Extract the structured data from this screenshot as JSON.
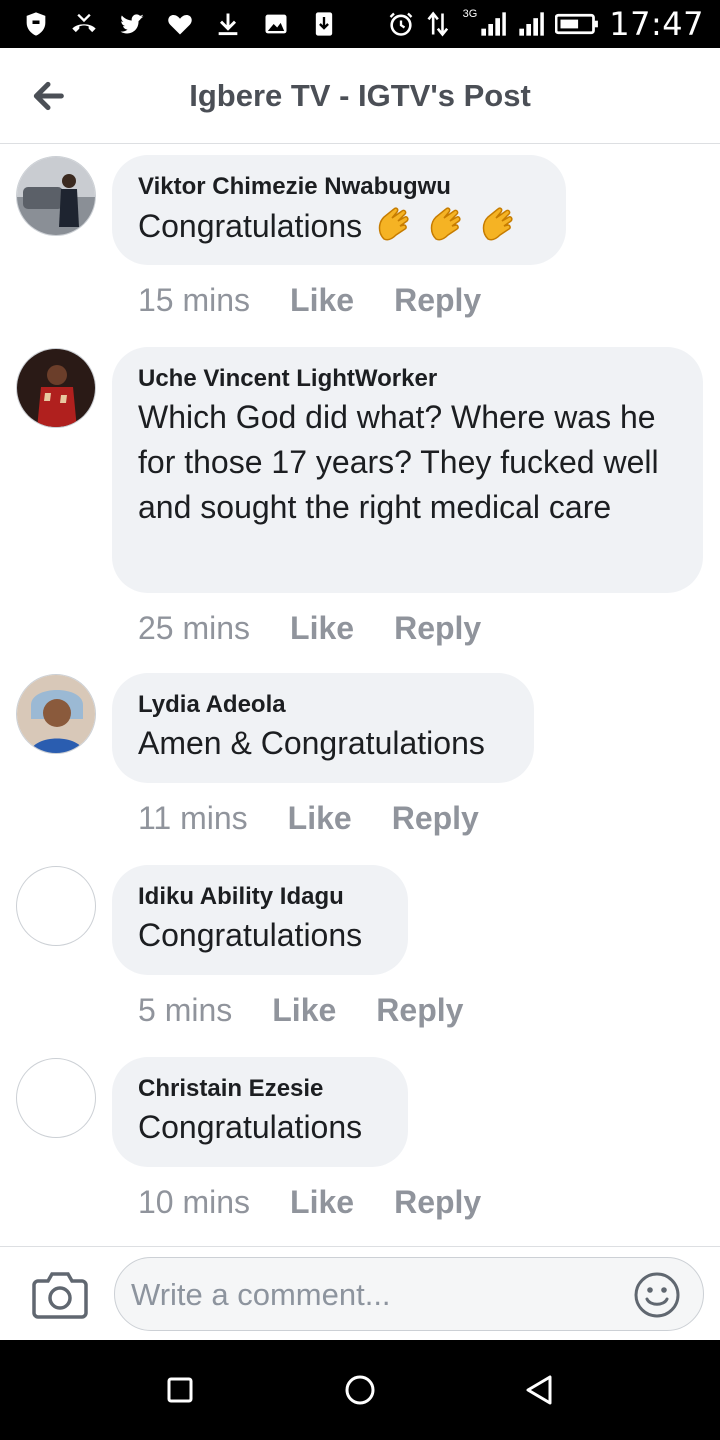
{
  "status_bar": {
    "time": "17:47",
    "network": "3G",
    "left_icons": [
      "shield-icon",
      "missed-call-icon",
      "twitter-icon",
      "heart-icon",
      "download-icon",
      "image-icon",
      "download-box-icon"
    ],
    "right_icons": [
      "alarm-icon",
      "data-arrows-icon",
      "signal-icon",
      "signal-icon",
      "battery-icon"
    ]
  },
  "header": {
    "title": "Igbere TV - IGTV's Post",
    "back_icon": "arrow-left-icon"
  },
  "comments": [
    {
      "author": "Viktor Chimezie Nwabugwu",
      "text": "Congratulations",
      "emoji": [
        "clapping-hands",
        "clapping-hands",
        "clapping-hands"
      ],
      "time": "15 mins",
      "like": "Like",
      "reply": "Reply"
    },
    {
      "author": "Uche Vincent LightWorker",
      "text": "Which God did what? Where was he for those 17 years? They fucked well and sought the right medical care",
      "time": "25 mins",
      "like": "Like",
      "reply": "Reply"
    },
    {
      "author": "Lydia Adeola",
      "text": "Amen & Congratulations",
      "time": "11 mins",
      "like": "Like",
      "reply": "Reply"
    },
    {
      "author": "Idiku Ability Idagu",
      "text": "Congratulations",
      "time": "5 mins",
      "like": "Like",
      "reply": "Reply"
    },
    {
      "author": "Christain Ezesie",
      "text": "Congratulations",
      "time": "10 mins",
      "like": "Like",
      "reply": "Reply"
    }
  ],
  "composer": {
    "placeholder": "Write a comment...",
    "value": "",
    "camera_icon": "camera-icon",
    "emoji_icon": "smiley-icon"
  },
  "nav_bar": {
    "icons": [
      "recents-square-icon",
      "home-circle-icon",
      "back-triangle-icon"
    ]
  }
}
